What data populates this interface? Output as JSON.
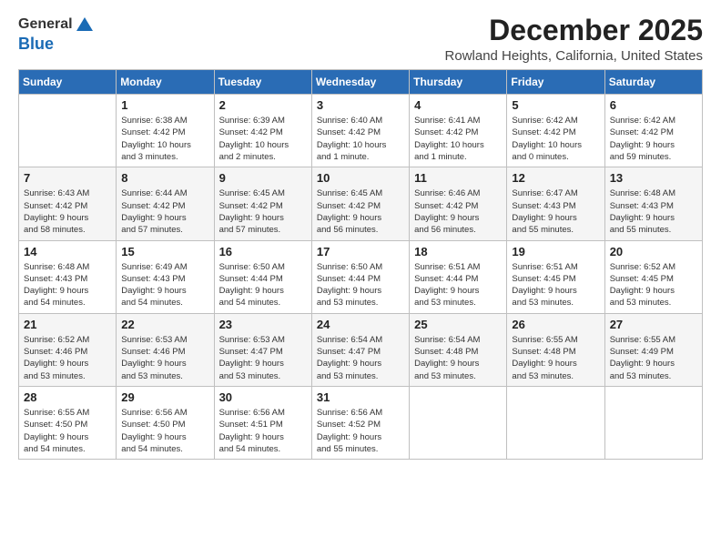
{
  "logo": {
    "general": "General",
    "blue": "Blue"
  },
  "header": {
    "title": "December 2025",
    "subtitle": "Rowland Heights, California, United States"
  },
  "weekdays": [
    "Sunday",
    "Monday",
    "Tuesday",
    "Wednesday",
    "Thursday",
    "Friday",
    "Saturday"
  ],
  "weeks": [
    [
      {
        "day": "",
        "info": ""
      },
      {
        "day": "1",
        "info": "Sunrise: 6:38 AM\nSunset: 4:42 PM\nDaylight: 10 hours\nand 3 minutes."
      },
      {
        "day": "2",
        "info": "Sunrise: 6:39 AM\nSunset: 4:42 PM\nDaylight: 10 hours\nand 2 minutes."
      },
      {
        "day": "3",
        "info": "Sunrise: 6:40 AM\nSunset: 4:42 PM\nDaylight: 10 hours\nand 1 minute."
      },
      {
        "day": "4",
        "info": "Sunrise: 6:41 AM\nSunset: 4:42 PM\nDaylight: 10 hours\nand 1 minute."
      },
      {
        "day": "5",
        "info": "Sunrise: 6:42 AM\nSunset: 4:42 PM\nDaylight: 10 hours\nand 0 minutes."
      },
      {
        "day": "6",
        "info": "Sunrise: 6:42 AM\nSunset: 4:42 PM\nDaylight: 9 hours\nand 59 minutes."
      }
    ],
    [
      {
        "day": "7",
        "info": "Sunrise: 6:43 AM\nSunset: 4:42 PM\nDaylight: 9 hours\nand 58 minutes."
      },
      {
        "day": "8",
        "info": "Sunrise: 6:44 AM\nSunset: 4:42 PM\nDaylight: 9 hours\nand 57 minutes."
      },
      {
        "day": "9",
        "info": "Sunrise: 6:45 AM\nSunset: 4:42 PM\nDaylight: 9 hours\nand 57 minutes."
      },
      {
        "day": "10",
        "info": "Sunrise: 6:45 AM\nSunset: 4:42 PM\nDaylight: 9 hours\nand 56 minutes."
      },
      {
        "day": "11",
        "info": "Sunrise: 6:46 AM\nSunset: 4:42 PM\nDaylight: 9 hours\nand 56 minutes."
      },
      {
        "day": "12",
        "info": "Sunrise: 6:47 AM\nSunset: 4:43 PM\nDaylight: 9 hours\nand 55 minutes."
      },
      {
        "day": "13",
        "info": "Sunrise: 6:48 AM\nSunset: 4:43 PM\nDaylight: 9 hours\nand 55 minutes."
      }
    ],
    [
      {
        "day": "14",
        "info": "Sunrise: 6:48 AM\nSunset: 4:43 PM\nDaylight: 9 hours\nand 54 minutes."
      },
      {
        "day": "15",
        "info": "Sunrise: 6:49 AM\nSunset: 4:43 PM\nDaylight: 9 hours\nand 54 minutes."
      },
      {
        "day": "16",
        "info": "Sunrise: 6:50 AM\nSunset: 4:44 PM\nDaylight: 9 hours\nand 54 minutes."
      },
      {
        "day": "17",
        "info": "Sunrise: 6:50 AM\nSunset: 4:44 PM\nDaylight: 9 hours\nand 53 minutes."
      },
      {
        "day": "18",
        "info": "Sunrise: 6:51 AM\nSunset: 4:44 PM\nDaylight: 9 hours\nand 53 minutes."
      },
      {
        "day": "19",
        "info": "Sunrise: 6:51 AM\nSunset: 4:45 PM\nDaylight: 9 hours\nand 53 minutes."
      },
      {
        "day": "20",
        "info": "Sunrise: 6:52 AM\nSunset: 4:45 PM\nDaylight: 9 hours\nand 53 minutes."
      }
    ],
    [
      {
        "day": "21",
        "info": "Sunrise: 6:52 AM\nSunset: 4:46 PM\nDaylight: 9 hours\nand 53 minutes."
      },
      {
        "day": "22",
        "info": "Sunrise: 6:53 AM\nSunset: 4:46 PM\nDaylight: 9 hours\nand 53 minutes."
      },
      {
        "day": "23",
        "info": "Sunrise: 6:53 AM\nSunset: 4:47 PM\nDaylight: 9 hours\nand 53 minutes."
      },
      {
        "day": "24",
        "info": "Sunrise: 6:54 AM\nSunset: 4:47 PM\nDaylight: 9 hours\nand 53 minutes."
      },
      {
        "day": "25",
        "info": "Sunrise: 6:54 AM\nSunset: 4:48 PM\nDaylight: 9 hours\nand 53 minutes."
      },
      {
        "day": "26",
        "info": "Sunrise: 6:55 AM\nSunset: 4:48 PM\nDaylight: 9 hours\nand 53 minutes."
      },
      {
        "day": "27",
        "info": "Sunrise: 6:55 AM\nSunset: 4:49 PM\nDaylight: 9 hours\nand 53 minutes."
      }
    ],
    [
      {
        "day": "28",
        "info": "Sunrise: 6:55 AM\nSunset: 4:50 PM\nDaylight: 9 hours\nand 54 minutes."
      },
      {
        "day": "29",
        "info": "Sunrise: 6:56 AM\nSunset: 4:50 PM\nDaylight: 9 hours\nand 54 minutes."
      },
      {
        "day": "30",
        "info": "Sunrise: 6:56 AM\nSunset: 4:51 PM\nDaylight: 9 hours\nand 54 minutes."
      },
      {
        "day": "31",
        "info": "Sunrise: 6:56 AM\nSunset: 4:52 PM\nDaylight: 9 hours\nand 55 minutes."
      },
      {
        "day": "",
        "info": ""
      },
      {
        "day": "",
        "info": ""
      },
      {
        "day": "",
        "info": ""
      }
    ]
  ]
}
